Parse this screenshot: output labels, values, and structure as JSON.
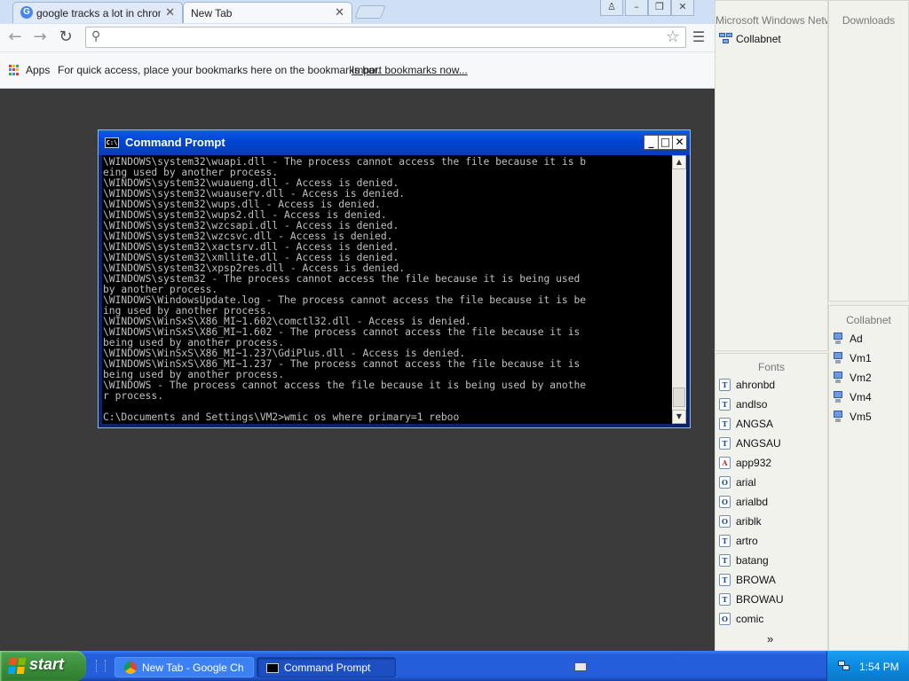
{
  "browser": {
    "tabs": [
      {
        "label": "google tracks a lot in chrome",
        "favicon": "google-g"
      },
      {
        "label": "New Tab"
      }
    ],
    "omnibox": {
      "value": "",
      "placeholder": ""
    },
    "bookmarks_bar": {
      "apps_label": "Apps",
      "message": "For quick access, place your bookmarks here on the bookmarks bar.",
      "import_link": "Import bookmarks now..."
    },
    "colors": {
      "tabstrip": "#cfe0f5",
      "page_background": "#3b3b3b"
    }
  },
  "cmd": {
    "title": "Command Prompt",
    "icon_text": "C:\\",
    "lines": [
      "\\WINDOWS\\system32\\wuapi.dll - The process cannot access the file because it is b",
      "eing used by another process.",
      "\\WINDOWS\\system32\\wuaueng.dll - Access is denied.",
      "\\WINDOWS\\system32\\wuauserv.dll - Access is denied.",
      "\\WINDOWS\\system32\\wups.dll - Access is denied.",
      "\\WINDOWS\\system32\\wups2.dll - Access is denied.",
      "\\WINDOWS\\system32\\wzcsapi.dll - Access is denied.",
      "\\WINDOWS\\system32\\wzcsvc.dll - Access is denied.",
      "\\WINDOWS\\system32\\xactsrv.dll - Access is denied.",
      "\\WINDOWS\\system32\\xmllite.dll - Access is denied.",
      "\\WINDOWS\\system32\\xpsp2res.dll - Access is denied.",
      "\\WINDOWS\\system32 - The process cannot access the file because it is being used",
      "by another process.",
      "\\WINDOWS\\WindowsUpdate.log - The process cannot access the file because it is be",
      "ing used by another process.",
      "\\WINDOWS\\WinSxS\\X86_MI~1.602\\comctl32.dll - Access is denied.",
      "\\WINDOWS\\WinSxS\\X86_MI~1.602 - The process cannot access the file because it is",
      "being used by another process.",
      "\\WINDOWS\\WinSxS\\X86_MI~1.237\\GdiPlus.dll - Access is denied.",
      "\\WINDOWS\\WinSxS\\X86_MI~1.237 - The process cannot access the file because it is",
      "being used by another process.",
      "\\WINDOWS - The process cannot access the file because it is being used by anothe",
      "r process.",
      "",
      "C:\\Documents and Settings\\VM2>wmic os where primary=1 reboo"
    ]
  },
  "panes": {
    "network": {
      "header": "Microsoft Windows Network",
      "items": [
        "Collabnet"
      ]
    },
    "downloads": {
      "header": "Downloads"
    },
    "collabnet": {
      "header": "Collabnet",
      "items": [
        "Ad",
        "Vm1",
        "Vm2",
        "Vm4",
        "Vm5"
      ]
    },
    "fonts": {
      "header": "Fonts",
      "items": [
        {
          "label": "ahronbd",
          "icon": "truetype-font-icon"
        },
        {
          "label": "andlso",
          "icon": "truetype-font-icon"
        },
        {
          "label": "ANGSA",
          "icon": "truetype-font-icon"
        },
        {
          "label": "ANGSAU",
          "icon": "truetype-font-icon"
        },
        {
          "label": "app932",
          "icon": "font-a-icon"
        },
        {
          "label": "arial",
          "icon": "opentype-font-icon"
        },
        {
          "label": "arialbd",
          "icon": "opentype-font-icon"
        },
        {
          "label": "ariblk",
          "icon": "opentype-font-icon"
        },
        {
          "label": "artro",
          "icon": "truetype-font-icon"
        },
        {
          "label": "batang",
          "icon": "truetype-font-icon"
        },
        {
          "label": "BROWA",
          "icon": "truetype-font-icon"
        },
        {
          "label": "BROWAU",
          "icon": "truetype-font-icon"
        },
        {
          "label": "comic",
          "icon": "opentype-font-icon"
        }
      ],
      "more": "»"
    }
  },
  "taskbar": {
    "start_label": "start",
    "tasks": [
      {
        "label": "New Tab - Google Ch...",
        "icon": "chrome-icon"
      },
      {
        "label": "Command Prompt",
        "icon": "cmd-icon"
      }
    ],
    "clock": "1:54 PM",
    "colors": {
      "bar": "#245edb",
      "start": "#3c8f3c",
      "tray": "#0d8ae0"
    }
  }
}
